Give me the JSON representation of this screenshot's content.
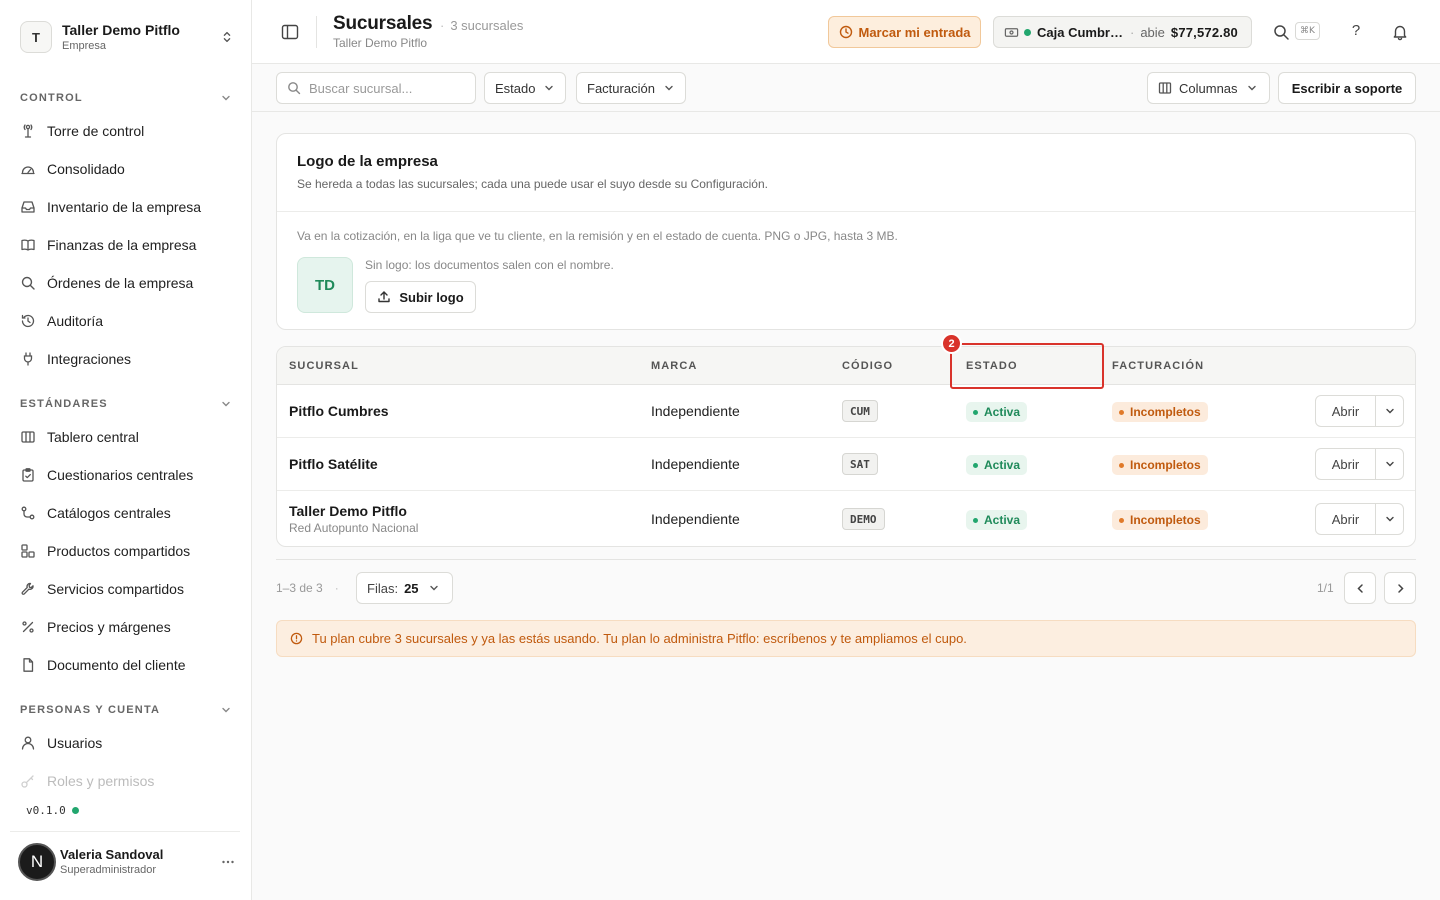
{
  "sidebar": {
    "org": {
      "initial": "T",
      "name": "Taller Demo Pitflo",
      "type": "Empresa"
    },
    "sections": [
      {
        "label": "CONTROL",
        "items": [
          {
            "label": "Torre de control",
            "icon": "tower-icon"
          },
          {
            "label": "Consolidado",
            "icon": "gauge-icon"
          },
          {
            "label": "Inventario de la empresa",
            "icon": "inbox-icon"
          },
          {
            "label": "Finanzas de la empresa",
            "icon": "book-icon"
          },
          {
            "label": "Órdenes de la empresa",
            "icon": "search-icon"
          },
          {
            "label": "Auditoría",
            "icon": "history-icon"
          },
          {
            "label": "Integraciones",
            "icon": "plug-icon"
          }
        ]
      },
      {
        "label": "ESTÁNDARES",
        "items": [
          {
            "label": "Tablero central",
            "icon": "columns-icon"
          },
          {
            "label": "Cuestionarios centrales",
            "icon": "clipboard-icon"
          },
          {
            "label": "Catálogos centrales",
            "icon": "catalog-icon"
          },
          {
            "label": "Productos compartidos",
            "icon": "boxes-icon"
          },
          {
            "label": "Servicios compartidos",
            "icon": "wrench-icon"
          },
          {
            "label": "Precios y márgenes",
            "icon": "percent-icon"
          },
          {
            "label": "Documento del cliente",
            "icon": "file-icon"
          }
        ]
      },
      {
        "label": "PERSONAS Y CUENTA",
        "items": [
          {
            "label": "Usuarios",
            "icon": "user-icon"
          },
          {
            "label": "Roles y permisos",
            "icon": "key-icon"
          }
        ]
      }
    ],
    "version": "v0.1.0",
    "user": {
      "initial": "N",
      "name": "Valeria Sandoval",
      "role": "Superadministrador"
    }
  },
  "header": {
    "title": "Sucursales",
    "count": "3 sucursales",
    "subtitle": "Taller Demo Pitflo",
    "entry_label": "Marcar mi entrada",
    "cash": {
      "name": "Caja Cumbr…",
      "state": "abie",
      "amount": "$77,572.80"
    },
    "shortcut": "⌘K",
    "help": "?"
  },
  "toolbar": {
    "search_placeholder": "Buscar sucursal...",
    "filter_status": "Estado",
    "filter_billing": "Facturación",
    "columns": "Columnas",
    "support": "Escribir a soporte"
  },
  "logo_card": {
    "title": "Logo de la empresa",
    "description": "Se hereda a todas las sucursales; cada una puede usar el suyo desde su Configuración.",
    "note": "Va en la cotización, en la liga que ve tu cliente, en la remisión y en el estado de cuenta. PNG o JPG, hasta 3 MB.",
    "placeholder_initials": "TD",
    "empty_text": "Sin logo: los documentos salen con el nombre.",
    "upload_label": "Subir logo"
  },
  "table": {
    "columns": [
      "SUCURSAL",
      "MARCA",
      "CÓDIGO",
      "ESTADO",
      "FACTURACIÓN"
    ],
    "rows": [
      {
        "name": "Pitflo Cumbres",
        "sub": "",
        "brand": "Independiente",
        "code": "CUM",
        "status": "Activa",
        "billing": "Incompletos",
        "action": "Abrir"
      },
      {
        "name": "Pitflo Satélite",
        "sub": "",
        "brand": "Independiente",
        "code": "SAT",
        "status": "Activa",
        "billing": "Incompletos",
        "action": "Abrir"
      },
      {
        "name": "Taller Demo Pitflo",
        "sub": "Red Autopunto Nacional",
        "brand": "Independiente",
        "code": "DEMO",
        "status": "Activa",
        "billing": "Incompletos",
        "action": "Abrir"
      }
    ]
  },
  "annotation": {
    "marker": "2"
  },
  "pagination": {
    "range": "1–3 de 3",
    "rows_label": "Filas:",
    "rows_value": "25",
    "pages": "1/1"
  },
  "alert": "Tu plan cubre 3 sucursales y ya las estás usando. Tu plan lo administra Pitflo: escríbenos y te ampliamos el cupo.",
  "colors": {
    "accent_orange": "#c05a0e",
    "success_green": "#22a66e",
    "highlight_red": "#d9332b"
  }
}
